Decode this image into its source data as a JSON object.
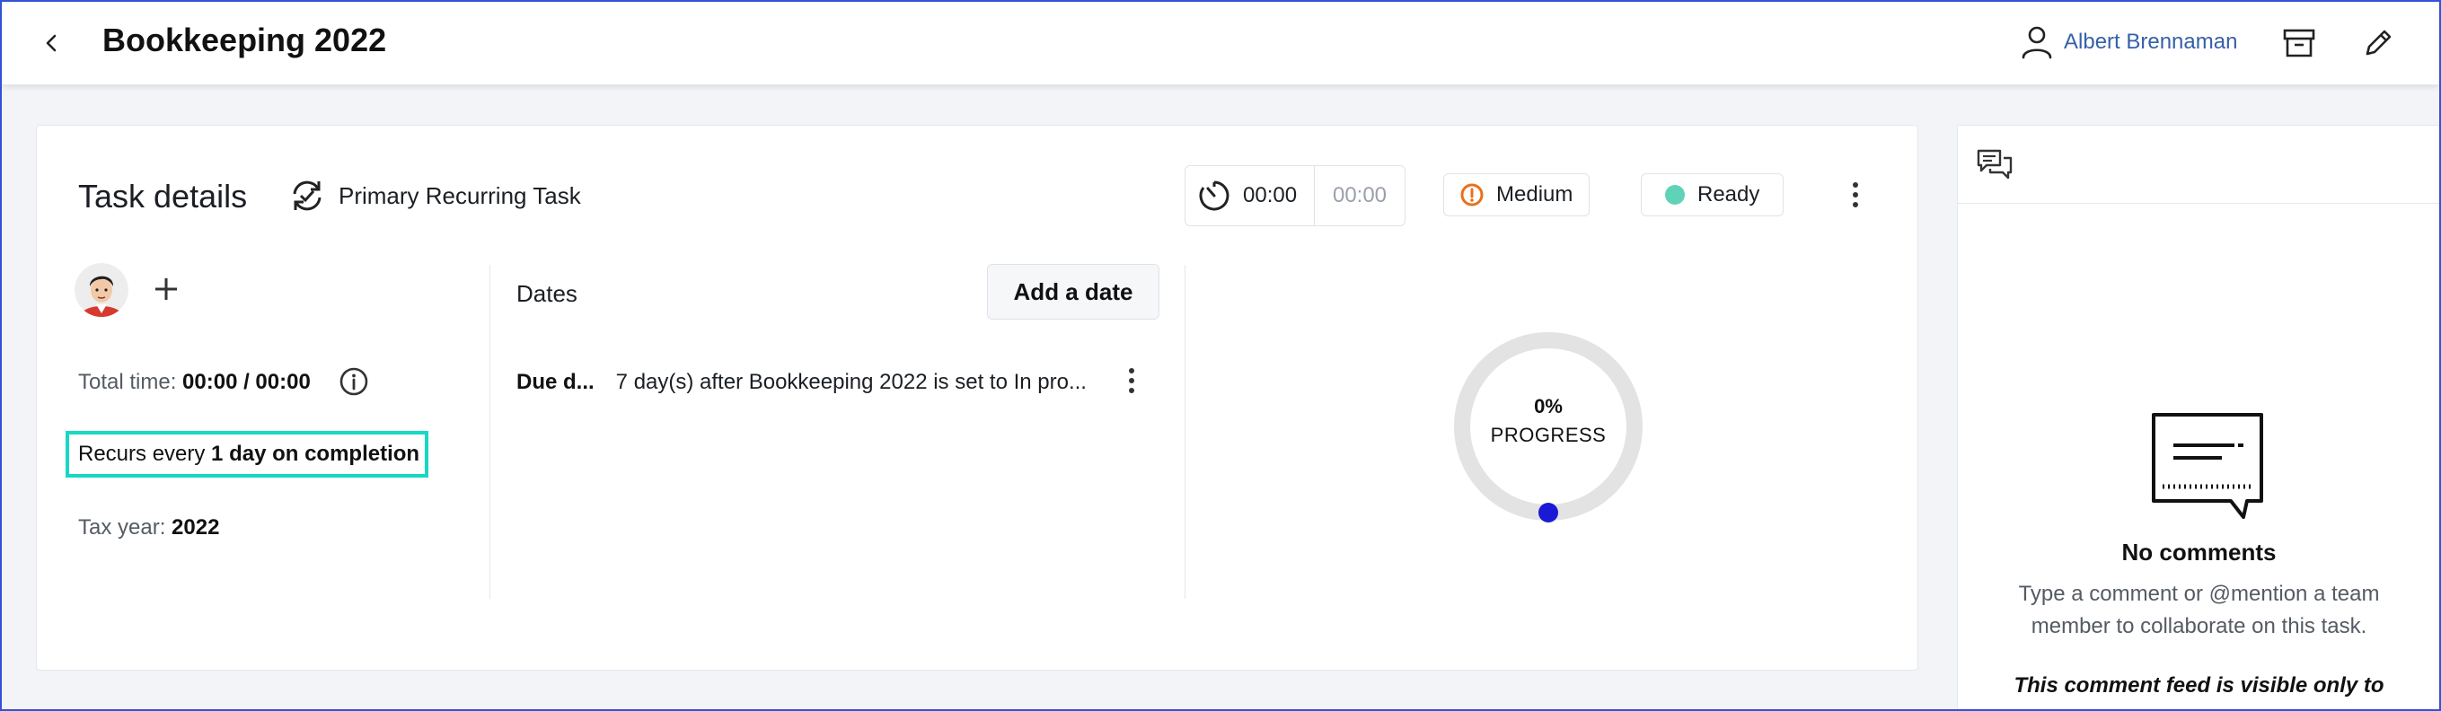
{
  "header": {
    "title": "Bookkeeping 2022",
    "user_name": "Albert Brennaman",
    "icons": [
      "chevron-left-icon",
      "user-icon",
      "archive-icon",
      "pencil-icon"
    ]
  },
  "task": {
    "section_title": "Task details",
    "recurring_label": "Primary Recurring Task",
    "timer": {
      "elapsed": "00:00",
      "estimate": "00:00"
    },
    "priority": {
      "label": "Medium",
      "color": "#e8711c"
    },
    "status": {
      "label": "Ready",
      "color": "#5fd3b8"
    },
    "total_time_label": "Total time:",
    "total_time_value": "00:00 / 00:00",
    "recurs_prefix": "Recurs every",
    "recurs_value": "1 day on completion",
    "tax_year_label": "Tax year:",
    "tax_year_value": "2022"
  },
  "dates": {
    "section_label": "Dates",
    "add_button": "Add a date",
    "rows": [
      {
        "label": "Due d...",
        "text": "7 day(s) after Bookkeeping 2022 is set to In pro..."
      }
    ]
  },
  "progress": {
    "percent_text": "0%",
    "label": "PROGRESS",
    "value": 0,
    "track_color": "#e3e3e3",
    "indicator_color": "#1a1ad6"
  },
  "comments": {
    "empty_title": "No comments",
    "empty_text": "Type a comment or @mention a team member to collaborate on this task.",
    "visibility_note": "This comment feed is visible only to"
  },
  "colors": {
    "accent": "#3660a8",
    "highlight": "#18d8c4",
    "frame": "#3350d8"
  }
}
